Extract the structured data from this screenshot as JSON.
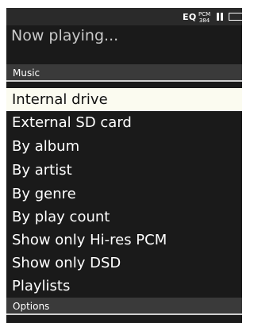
{
  "status_bar": {
    "eq": "EQ",
    "pcm_top": "PCM",
    "pcm_bottom": "384",
    "playback_state_icon": "pause-icon",
    "battery_icon": "battery-icon"
  },
  "now_playing": "Now playing...",
  "sections": {
    "music": "Music",
    "options": "Options"
  },
  "menu": {
    "selected_index": 0,
    "items": [
      "Internal drive",
      "External SD card",
      "By album",
      "By artist",
      "By genre",
      "By play count",
      "Show only Hi-res PCM",
      "Show only DSD",
      "Playlists"
    ]
  },
  "colors": {
    "background": "#1a1a1a",
    "header": "#3a3a3a",
    "highlight": "#fbfbf0"
  }
}
